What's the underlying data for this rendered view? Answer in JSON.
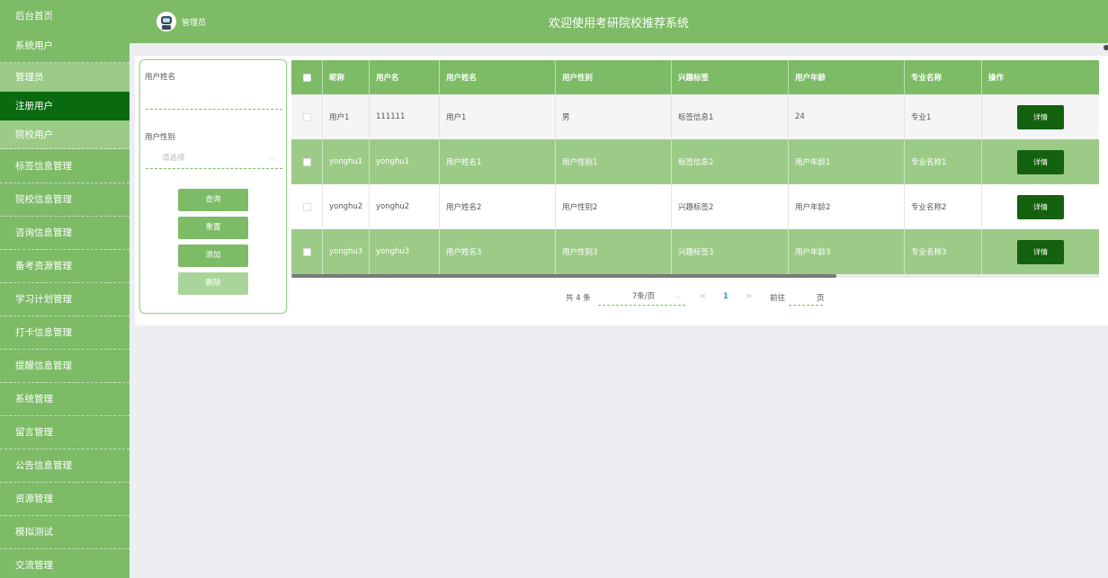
{
  "header": {
    "role": "管理员",
    "title": "欢迎使用考研院校推荐系统"
  },
  "sidebar": {
    "items": [
      {
        "label": "后台首页"
      },
      {
        "label": "系统用户"
      },
      {
        "label": "管理员"
      },
      {
        "label": "注册用户"
      },
      {
        "label": "院校用户"
      },
      {
        "label": "标签信息管理"
      },
      {
        "label": "院校信息管理"
      },
      {
        "label": "咨询信息管理"
      },
      {
        "label": "备考资源管理"
      },
      {
        "label": "学习计划管理"
      },
      {
        "label": "打卡信息管理"
      },
      {
        "label": "提醒信息管理"
      },
      {
        "label": "系统管理"
      },
      {
        "label": "留言管理"
      },
      {
        "label": "公告信息管理"
      },
      {
        "label": "资源管理"
      },
      {
        "label": "模拟测试"
      },
      {
        "label": "交流管理"
      }
    ]
  },
  "filter": {
    "name_label": "用户姓名",
    "name_value": "",
    "gender_label": "用户性别",
    "gender_placeholder": "请选择",
    "buttons": {
      "query": "查询",
      "reset": "重置",
      "add": "添加",
      "delete": "删除"
    }
  },
  "table": {
    "columns": [
      "昵称",
      "用户名",
      "用户姓名",
      "用户性别",
      "兴趣标签",
      "用户年龄",
      "专业名称",
      "操作"
    ],
    "rows": [
      {
        "nickname": "用户1",
        "username": "111111",
        "name": "用户1",
        "gender": "男",
        "tag": "标签信息1",
        "age": "24",
        "major": "专业1",
        "action": "详情"
      },
      {
        "nickname": "yonghu1",
        "username": "yonghu1",
        "name": "用户姓名1",
        "gender": "用户性别1",
        "tag": "标签信息2",
        "age": "用户年龄1",
        "major": "专业名称1",
        "action": "详情"
      },
      {
        "nickname": "yonghu2",
        "username": "yonghu2",
        "name": "用户姓名2",
        "gender": "用户性别2",
        "tag": "兴趣标签2",
        "age": "用户年龄2",
        "major": "专业名称2",
        "action": "详情"
      },
      {
        "nickname": "yonghu3",
        "username": "yonghu3",
        "name": "用户姓名3",
        "gender": "用户性别3",
        "tag": "兴趣标签3",
        "age": "用户年龄3",
        "major": "专业名称3",
        "action": "详情"
      }
    ]
  },
  "pagination": {
    "total": "共 4 条",
    "page_size": "7条/页",
    "prev": "<",
    "current_page": "1",
    "next": ">",
    "goto_label": "前往",
    "page_unit": "页"
  },
  "colors": {
    "primary": "#7dbb66",
    "active": "#0a6a10",
    "detail_button": "#14610f"
  }
}
